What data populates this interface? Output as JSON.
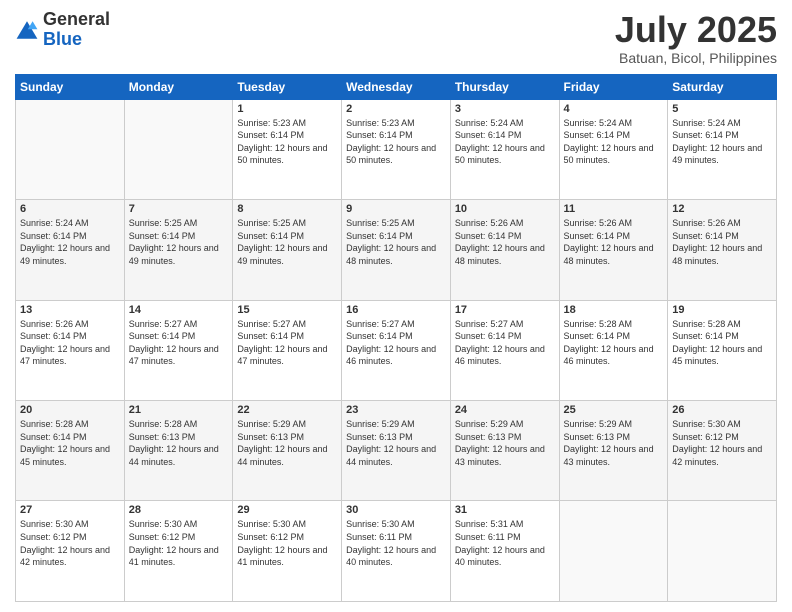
{
  "header": {
    "logo_general": "General",
    "logo_blue": "Blue",
    "month": "July 2025",
    "location": "Batuan, Bicol, Philippines"
  },
  "weekdays": [
    "Sunday",
    "Monday",
    "Tuesday",
    "Wednesday",
    "Thursday",
    "Friday",
    "Saturday"
  ],
  "weeks": [
    [
      {
        "day": "",
        "info": ""
      },
      {
        "day": "",
        "info": ""
      },
      {
        "day": "1",
        "info": "Sunrise: 5:23 AM\nSunset: 6:14 PM\nDaylight: 12 hours and 50 minutes."
      },
      {
        "day": "2",
        "info": "Sunrise: 5:23 AM\nSunset: 6:14 PM\nDaylight: 12 hours and 50 minutes."
      },
      {
        "day": "3",
        "info": "Sunrise: 5:24 AM\nSunset: 6:14 PM\nDaylight: 12 hours and 50 minutes."
      },
      {
        "day": "4",
        "info": "Sunrise: 5:24 AM\nSunset: 6:14 PM\nDaylight: 12 hours and 50 minutes."
      },
      {
        "day": "5",
        "info": "Sunrise: 5:24 AM\nSunset: 6:14 PM\nDaylight: 12 hours and 49 minutes."
      }
    ],
    [
      {
        "day": "6",
        "info": "Sunrise: 5:24 AM\nSunset: 6:14 PM\nDaylight: 12 hours and 49 minutes."
      },
      {
        "day": "7",
        "info": "Sunrise: 5:25 AM\nSunset: 6:14 PM\nDaylight: 12 hours and 49 minutes."
      },
      {
        "day": "8",
        "info": "Sunrise: 5:25 AM\nSunset: 6:14 PM\nDaylight: 12 hours and 49 minutes."
      },
      {
        "day": "9",
        "info": "Sunrise: 5:25 AM\nSunset: 6:14 PM\nDaylight: 12 hours and 48 minutes."
      },
      {
        "day": "10",
        "info": "Sunrise: 5:26 AM\nSunset: 6:14 PM\nDaylight: 12 hours and 48 minutes."
      },
      {
        "day": "11",
        "info": "Sunrise: 5:26 AM\nSunset: 6:14 PM\nDaylight: 12 hours and 48 minutes."
      },
      {
        "day": "12",
        "info": "Sunrise: 5:26 AM\nSunset: 6:14 PM\nDaylight: 12 hours and 48 minutes."
      }
    ],
    [
      {
        "day": "13",
        "info": "Sunrise: 5:26 AM\nSunset: 6:14 PM\nDaylight: 12 hours and 47 minutes."
      },
      {
        "day": "14",
        "info": "Sunrise: 5:27 AM\nSunset: 6:14 PM\nDaylight: 12 hours and 47 minutes."
      },
      {
        "day": "15",
        "info": "Sunrise: 5:27 AM\nSunset: 6:14 PM\nDaylight: 12 hours and 47 minutes."
      },
      {
        "day": "16",
        "info": "Sunrise: 5:27 AM\nSunset: 6:14 PM\nDaylight: 12 hours and 46 minutes."
      },
      {
        "day": "17",
        "info": "Sunrise: 5:27 AM\nSunset: 6:14 PM\nDaylight: 12 hours and 46 minutes."
      },
      {
        "day": "18",
        "info": "Sunrise: 5:28 AM\nSunset: 6:14 PM\nDaylight: 12 hours and 46 minutes."
      },
      {
        "day": "19",
        "info": "Sunrise: 5:28 AM\nSunset: 6:14 PM\nDaylight: 12 hours and 45 minutes."
      }
    ],
    [
      {
        "day": "20",
        "info": "Sunrise: 5:28 AM\nSunset: 6:14 PM\nDaylight: 12 hours and 45 minutes."
      },
      {
        "day": "21",
        "info": "Sunrise: 5:28 AM\nSunset: 6:13 PM\nDaylight: 12 hours and 44 minutes."
      },
      {
        "day": "22",
        "info": "Sunrise: 5:29 AM\nSunset: 6:13 PM\nDaylight: 12 hours and 44 minutes."
      },
      {
        "day": "23",
        "info": "Sunrise: 5:29 AM\nSunset: 6:13 PM\nDaylight: 12 hours and 44 minutes."
      },
      {
        "day": "24",
        "info": "Sunrise: 5:29 AM\nSunset: 6:13 PM\nDaylight: 12 hours and 43 minutes."
      },
      {
        "day": "25",
        "info": "Sunrise: 5:29 AM\nSunset: 6:13 PM\nDaylight: 12 hours and 43 minutes."
      },
      {
        "day": "26",
        "info": "Sunrise: 5:30 AM\nSunset: 6:12 PM\nDaylight: 12 hours and 42 minutes."
      }
    ],
    [
      {
        "day": "27",
        "info": "Sunrise: 5:30 AM\nSunset: 6:12 PM\nDaylight: 12 hours and 42 minutes."
      },
      {
        "day": "28",
        "info": "Sunrise: 5:30 AM\nSunset: 6:12 PM\nDaylight: 12 hours and 41 minutes."
      },
      {
        "day": "29",
        "info": "Sunrise: 5:30 AM\nSunset: 6:12 PM\nDaylight: 12 hours and 41 minutes."
      },
      {
        "day": "30",
        "info": "Sunrise: 5:30 AM\nSunset: 6:11 PM\nDaylight: 12 hours and 40 minutes."
      },
      {
        "day": "31",
        "info": "Sunrise: 5:31 AM\nSunset: 6:11 PM\nDaylight: 12 hours and 40 minutes."
      },
      {
        "day": "",
        "info": ""
      },
      {
        "day": "",
        "info": ""
      }
    ]
  ]
}
